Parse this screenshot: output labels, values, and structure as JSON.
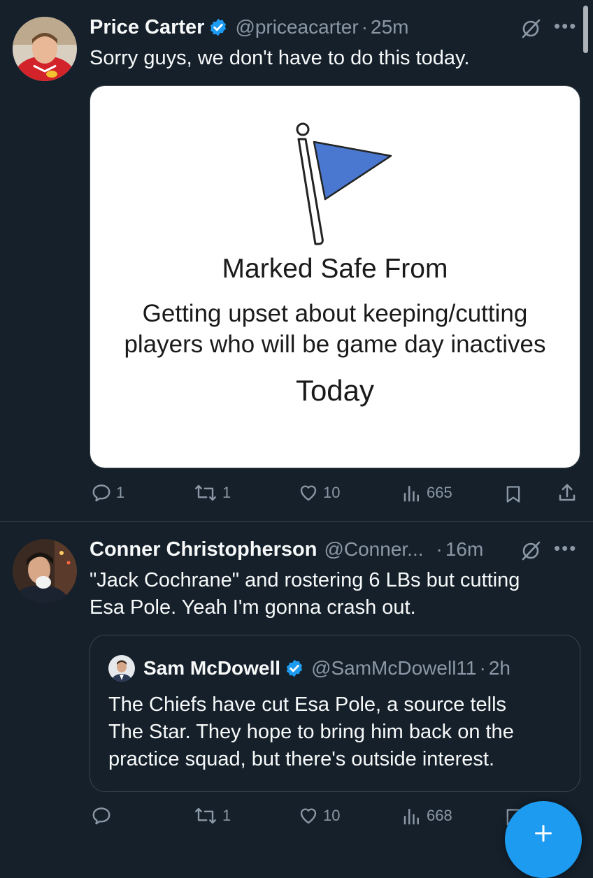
{
  "tweet1": {
    "name": "Price Carter",
    "handle": "@priceacarter",
    "dot": "·",
    "time": "25m",
    "text": "Sorry guys, we don't have to do this today.",
    "meme": {
      "title": "Marked Safe From",
      "line1": "Getting upset about keeping/cutting",
      "line2": "players who will be game day inactives",
      "line3": "Today"
    },
    "replies": "1",
    "retweets": "1",
    "likes": "10",
    "views": "665"
  },
  "tweet2": {
    "name": "Conner Christopherson",
    "handle": "@Conner...",
    "dot": "·",
    "time": "16m",
    "text_line1": "\"Jack Cochrane\" and rostering 6 LBs but cutting",
    "text_line2": "Esa Pole. Yeah I'm gonna crash out.",
    "quote": {
      "name": "Sam McDowell",
      "handle": "@SamMcDowell11",
      "dot": "·",
      "time": "2h",
      "line1": "The Chiefs have cut Esa Pole, a source tells",
      "line2": "The Star. They hope to bring him back on the",
      "line3": "practice squad, but there's outside interest."
    },
    "retweets": "1",
    "likes": "10",
    "views": "668"
  },
  "colors": {
    "background": "#15202b",
    "verified": "#1d9bf0",
    "muted": "#8b98a5",
    "fab": "#1d9bf0",
    "flag": "#4a78d0"
  },
  "icons": [
    "verified-badge-icon",
    "grok-icon",
    "more-icon",
    "reply-icon",
    "retweet-icon",
    "like-icon",
    "views-icon",
    "bookmark-icon",
    "share-icon",
    "compose-icon"
  ]
}
